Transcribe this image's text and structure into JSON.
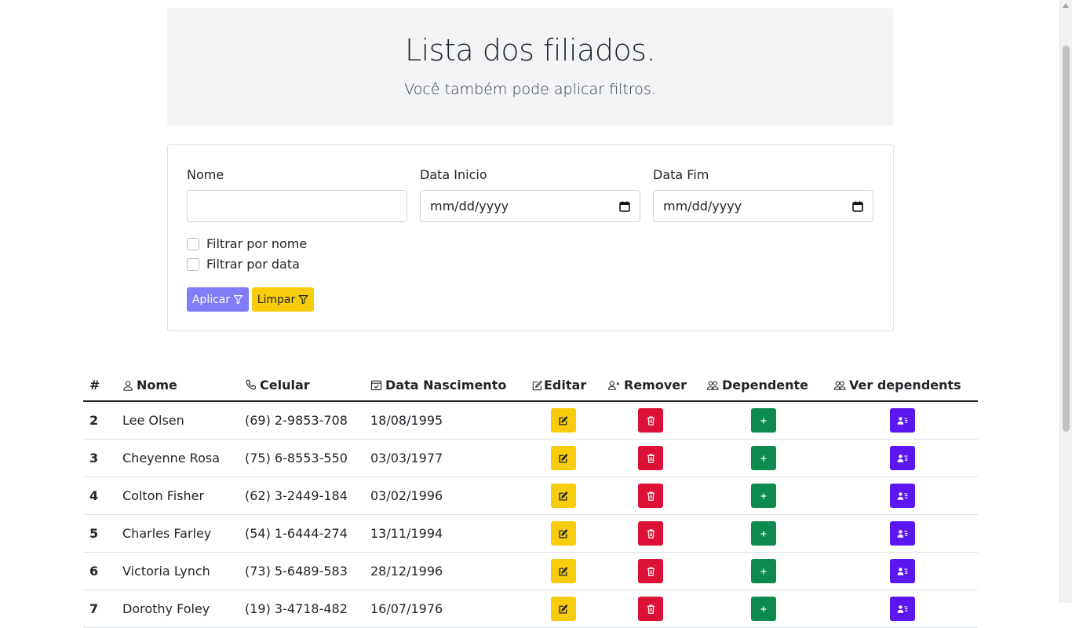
{
  "hero": {
    "title": "Lista dos filiados.",
    "subtitle": "Você também pode aplicar filtros."
  },
  "filters": {
    "name_label": "Nome",
    "name_value": "",
    "date_start_label": "Data Inicio",
    "date_start_value": "mm/dd/yyyy",
    "date_end_label": "Data Fim",
    "date_end_value": "mm/dd/yyyy",
    "filter_by_name_label": "Filtrar por nome",
    "filter_by_date_label": "Filtrar por data",
    "apply_label": "Aplicar",
    "clear_label": "Limpar"
  },
  "table": {
    "headers": {
      "num": "#",
      "name": "Nome",
      "phone": "Celular",
      "birth": "Data Nascimento",
      "edit": "Editar",
      "remove": "Remover",
      "dependent": "Dependente",
      "view_dependents": "Ver dependents"
    },
    "rows": [
      {
        "num": "2",
        "name": "Lee Olsen",
        "phone": "(69) 2-9853-708",
        "birth": "18/08/1995"
      },
      {
        "num": "3",
        "name": "Cheyenne Rosa",
        "phone": "(75) 6-8553-550",
        "birth": "03/03/1977"
      },
      {
        "num": "4",
        "name": "Colton Fisher",
        "phone": "(62) 3-2449-184",
        "birth": "03/02/1996"
      },
      {
        "num": "5",
        "name": "Charles Farley",
        "phone": "(54) 1-6444-274",
        "birth": "13/11/1994"
      },
      {
        "num": "6",
        "name": "Victoria Lynch",
        "phone": "(73) 5-6489-583",
        "birth": "28/12/1996"
      },
      {
        "num": "7",
        "name": "Dorothy Foley",
        "phone": "(19) 3-4718-482",
        "birth": "16/07/1976"
      }
    ]
  },
  "colors": {
    "apply": "#7f7df9",
    "clear": "#f6cc0d",
    "edit": "#f6cc0d",
    "remove": "#dc1136",
    "dependent": "#0d8a4f",
    "view": "#5a17f0"
  }
}
